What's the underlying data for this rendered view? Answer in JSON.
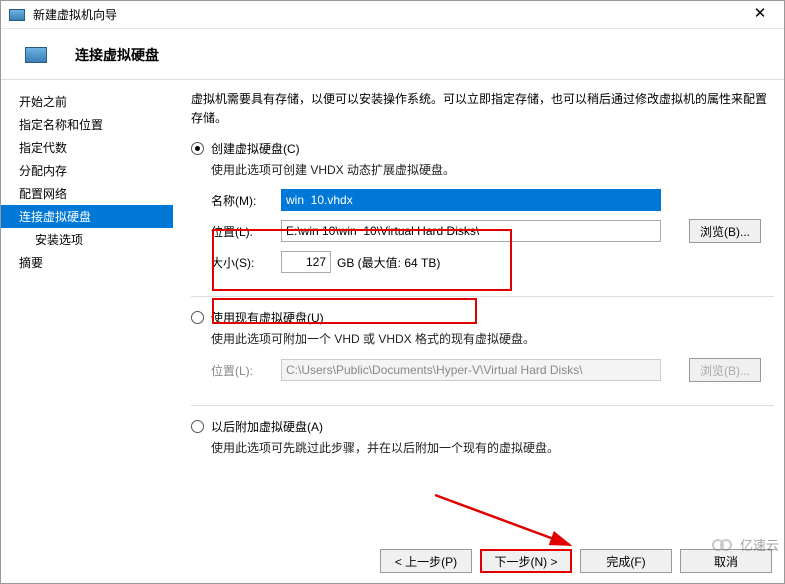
{
  "window": {
    "title": "新建虚拟机向导",
    "close_glyph": "✕"
  },
  "header": {
    "title": "连接虚拟硬盘"
  },
  "sidebar": {
    "steps": [
      "开始之前",
      "指定名称和位置",
      "指定代数",
      "分配内存",
      "配置网络",
      "连接虚拟硬盘",
      "安装选项",
      "摘要"
    ],
    "active_index": 5,
    "sub_index": 6
  },
  "main": {
    "description": "虚拟机需要具有存储，以便可以安装操作系统。可以立即指定存储，也可以稍后通过修改虚拟机的属性来配置存储。",
    "opt_create": {
      "label": "创建虚拟硬盘(C)",
      "help": "使用此选项可创建 VHDX 动态扩展虚拟硬盘。",
      "name_label": "名称(M):",
      "name_value": "win  10.vhdx",
      "loc_label": "位置(L):",
      "loc_value": "E:\\win 10\\win  10\\Virtual Hard Disks\\",
      "browse_label": "浏览(B)...",
      "size_label": "大小(S):",
      "size_value": "127",
      "size_unit": "GB (最大值: 64 TB)"
    },
    "opt_existing": {
      "label": "使用现有虚拟硬盘(U)",
      "help": "使用此选项可附加一个 VHD 或 VHDX 格式的现有虚拟硬盘。",
      "loc_label": "位置(L):",
      "loc_value": "C:\\Users\\Public\\Documents\\Hyper-V\\Virtual Hard Disks\\",
      "browse_label": "浏览(B)..."
    },
    "opt_later": {
      "label": "以后附加虚拟硬盘(A)",
      "help": "使用此选项可先跳过此步骤，并在以后附加一个现有的虚拟硬盘。"
    }
  },
  "footer": {
    "prev": "< 上一步(P)",
    "next": "下一步(N) >",
    "finish": "完成(F)",
    "cancel": "取消"
  },
  "watermark": "亿速云"
}
